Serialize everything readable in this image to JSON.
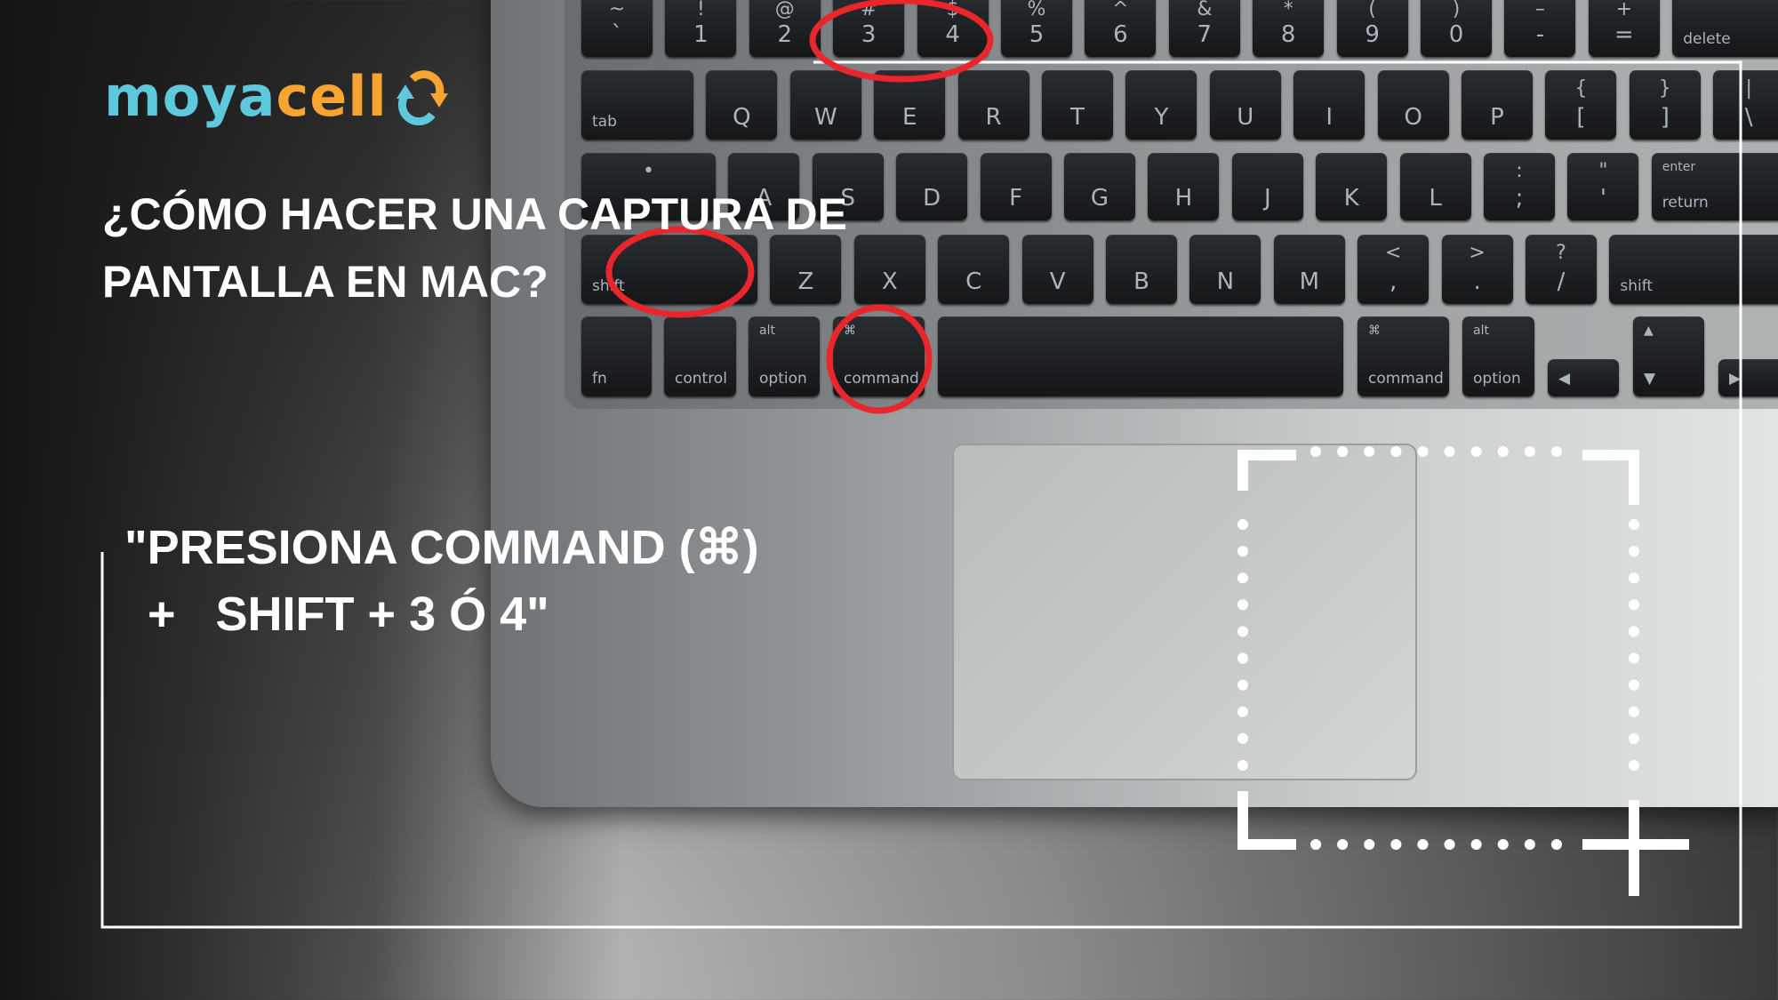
{
  "logo": {
    "part1": "moya",
    "part2": "cell",
    "colors": {
      "blue": "#5ec8dc",
      "orange": "#f7a530"
    }
  },
  "title": {
    "line1": "¿CÓMO HACER UNA CAPTURA DE",
    "line2": "PANTALLA EN MAC?"
  },
  "instruction": {
    "line1": "\"PRESIONA COMMAND (⌘)",
    "line2": "+   SHIFT + 3 Ó 4\""
  },
  "highlight_color": "#e8262b",
  "keyboard": {
    "row0": [
      [
        "~",
        "`"
      ],
      [
        "!",
        "1"
      ],
      [
        "@",
        "2"
      ],
      [
        "#",
        "3"
      ],
      [
        "$",
        "4"
      ],
      [
        "%",
        "5"
      ],
      [
        "^",
        "6"
      ],
      [
        "&",
        "7"
      ],
      [
        "*",
        "8"
      ],
      [
        "(",
        "9"
      ],
      [
        ")",
        "0"
      ],
      [
        "–",
        "-"
      ],
      [
        "+",
        "="
      ],
      [
        "",
        "delete"
      ]
    ],
    "row1": [
      [
        "",
        "tab"
      ],
      [
        "",
        "Q"
      ],
      [
        "",
        "W"
      ],
      [
        "",
        "E"
      ],
      [
        "",
        "R"
      ],
      [
        "",
        "T"
      ],
      [
        "",
        "Y"
      ],
      [
        "",
        "U"
      ],
      [
        "",
        "I"
      ],
      [
        "",
        "O"
      ],
      [
        "",
        "P"
      ],
      [
        "{",
        "["
      ],
      [
        "}",
        "]"
      ],
      [
        "|",
        "\\"
      ]
    ],
    "row2": [
      [
        "•",
        ""
      ],
      [
        "",
        "A"
      ],
      [
        "",
        "S"
      ],
      [
        "",
        "D"
      ],
      [
        "",
        "F"
      ],
      [
        "",
        "G"
      ],
      [
        "",
        "H"
      ],
      [
        "",
        "J"
      ],
      [
        "",
        "K"
      ],
      [
        "",
        "L"
      ],
      [
        ":",
        ";"
      ],
      [
        "\"",
        "'"
      ],
      [
        "enter",
        "return"
      ]
    ],
    "row3": [
      [
        "",
        "shift"
      ],
      [
        "",
        "Z"
      ],
      [
        "",
        "X"
      ],
      [
        "",
        "C"
      ],
      [
        "",
        "V"
      ],
      [
        "",
        "B"
      ],
      [
        "",
        "N"
      ],
      [
        "",
        "M"
      ],
      [
        "<",
        ","
      ],
      [
        ">",
        "."
      ],
      [
        "?",
        "/"
      ],
      [
        "",
        "shift"
      ]
    ],
    "row4": [
      [
        "",
        "fn"
      ],
      [
        "",
        "control"
      ],
      [
        "alt",
        "option"
      ],
      [
        "⌘",
        "command"
      ],
      [
        "",
        ""
      ],
      [
        "⌘",
        "command"
      ],
      [
        "alt",
        "option"
      ],
      [
        "",
        "◀"
      ],
      [
        "▲",
        "▼"
      ],
      [
        "",
        "▶"
      ]
    ]
  }
}
